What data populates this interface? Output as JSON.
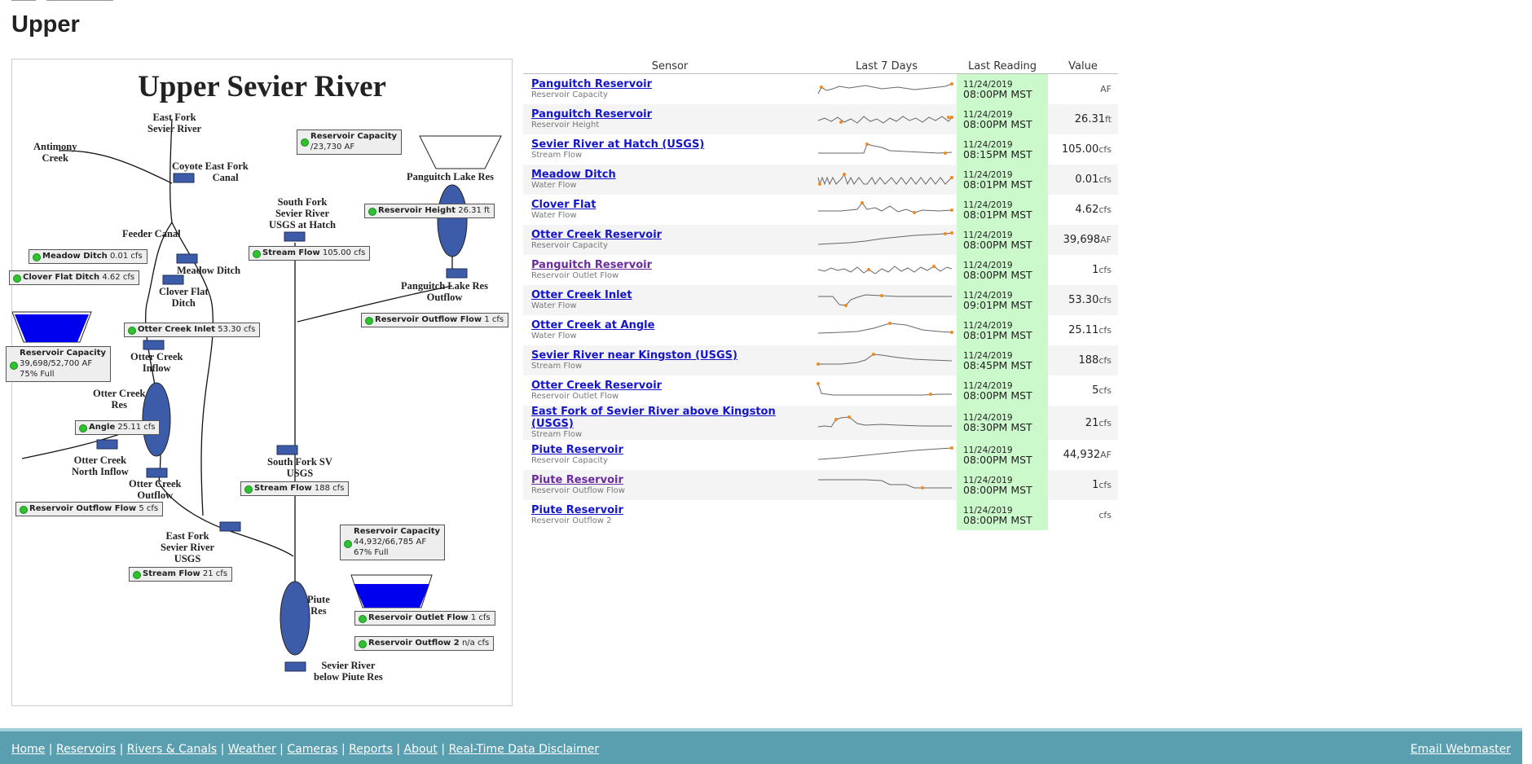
{
  "page": {
    "title": "Upper"
  },
  "diagram": {
    "title": "Upper Sevier River",
    "labels": {
      "east_fork": "East Fork\nSevier River",
      "antimony": "Antimony\nCreek",
      "coyote": "Coyote East Fork\nCanal",
      "feeder": "Feeder Canal",
      "meadow_ditch": "Meadow Ditch",
      "clover_flat": "Clover Flat\nDitch",
      "otter_inflow": "Otter Creek\nInflow",
      "otter_res": "Otter Creek\nRes",
      "otter_north": "Otter Creek\nNorth Inflow",
      "otter_outflow": "Otter Creek\nOutflow",
      "ef_usgs": "East Fork\nSevier River\nUSGS",
      "south_fork_hatch": "South Fork\nSevier River\nUSGS at Hatch",
      "panguitch_res": "Panguitch Lake Res",
      "panguitch_outflow": "Panguitch Lake Res\nOutflow",
      "sf_usgs": "South Fork SV\nUSGS",
      "piute_res": "Piute\nRes",
      "below_piute": "Sevier River\nbelow Piute Res"
    },
    "boxes": {
      "pang_cap": {
        "title": "Reservoir Capacity",
        "line": "/23,730 AF"
      },
      "pang_height": {
        "name": "Reservoir Height",
        "value": "26.31 ft"
      },
      "meadow": {
        "name": "Meadow Ditch",
        "value": "0.01 cfs"
      },
      "clover": {
        "name": "Clover Flat Ditch",
        "value": "4.62 cfs"
      },
      "hatch_flow": {
        "name": "Stream Flow",
        "value": "105.00 cfs"
      },
      "pang_outflow": {
        "name": "Reservoir Outflow Flow",
        "value": "1 cfs"
      },
      "otter_inlet": {
        "name": "Otter Creek Inlet",
        "value": "53.30 cfs"
      },
      "otter_cap": {
        "title": "Reservoir Capacity",
        "line1": "39,698/52,700 AF",
        "line2": "75% Full"
      },
      "angle": {
        "name": "Angle",
        "value": "25.11 cfs"
      },
      "otter_outflow": {
        "name": "Reservoir Outflow Flow",
        "value": "5 cfs"
      },
      "sf_flow": {
        "name": "Stream Flow",
        "value": "188 cfs"
      },
      "ef_flow": {
        "name": "Stream Flow",
        "value": "21 cfs"
      },
      "piute_cap": {
        "title": "Reservoir Capacity",
        "line1": "44,932/66,785 AF",
        "line2": "67% Full"
      },
      "piute_outflow": {
        "name": "Reservoir Outlet Flow",
        "value": "1 cfs"
      },
      "piute_outflow2": {
        "name": "Reservoir Outflow 2",
        "value": "n/a cfs"
      }
    }
  },
  "table": {
    "headers": {
      "sensor": "Sensor",
      "days": "Last 7 Days",
      "reading": "Last Reading",
      "value": "Value"
    },
    "rows": [
      {
        "name": "Panguitch Reservoir",
        "sub": "Reservoir Capacity",
        "date": "11/24/2019",
        "time": "08:00PM MST",
        "value": "",
        "unit": "AF"
      },
      {
        "name": "Panguitch Reservoir",
        "sub": "Reservoir Height",
        "date": "11/24/2019",
        "time": "08:00PM MST",
        "value": "26.31",
        "unit": "ft"
      },
      {
        "name": "Sevier River at Hatch (USGS)",
        "sub": "Stream Flow",
        "date": "11/24/2019",
        "time": "08:15PM MST",
        "value": "105.00",
        "unit": "cfs"
      },
      {
        "name": "Meadow Ditch",
        "sub": "Water Flow",
        "date": "11/24/2019",
        "time": "08:01PM MST",
        "value": "0.01",
        "unit": "cfs"
      },
      {
        "name": "Clover Flat",
        "sub": "Water Flow",
        "date": "11/24/2019",
        "time": "08:01PM MST",
        "value": "4.62",
        "unit": "cfs"
      },
      {
        "name": "Otter Creek Reservoir",
        "sub": "Reservoir Capacity",
        "date": "11/24/2019",
        "time": "08:00PM MST",
        "value": "39,698",
        "unit": "AF"
      },
      {
        "name": "Panguitch Reservoir",
        "sub": "Reservoir Outlet Flow",
        "date": "11/24/2019",
        "time": "08:00PM MST",
        "value": "1",
        "unit": "cfs"
      },
      {
        "name": "Otter Creek Inlet",
        "sub": "Water Flow",
        "date": "11/24/2019",
        "time": "09:01PM MST",
        "value": "53.30",
        "unit": "cfs"
      },
      {
        "name": "Otter Creek at Angle",
        "sub": "Water Flow",
        "date": "11/24/2019",
        "time": "08:01PM MST",
        "value": "25.11",
        "unit": "cfs"
      },
      {
        "name": "Sevier River near Kingston (USGS)",
        "sub": "Stream Flow",
        "date": "11/24/2019",
        "time": "08:45PM MST",
        "value": "188",
        "unit": "cfs"
      },
      {
        "name": "Otter Creek Reservoir",
        "sub": "Reservoir Outlet Flow",
        "date": "11/24/2019",
        "time": "08:00PM MST",
        "value": "5",
        "unit": "cfs"
      },
      {
        "name": "East Fork of Sevier River above Kingston (USGS)",
        "sub": "Stream Flow",
        "date": "11/24/2019",
        "time": "08:30PM MST",
        "value": "21",
        "unit": "cfs"
      },
      {
        "name": "Piute Reservoir",
        "sub": "Reservoir Capacity",
        "date": "11/24/2019",
        "time": "08:00PM MST",
        "value": "44,932",
        "unit": "AF"
      },
      {
        "name": "Piute Reservoir",
        "sub": "Reservoir Outflow Flow",
        "date": "11/24/2019",
        "time": "08:00PM MST",
        "value": "1",
        "unit": "cfs"
      },
      {
        "name": "Piute Reservoir",
        "sub": "Reservoir Outflow 2",
        "date": "11/24/2019",
        "time": "08:00PM MST",
        "value": "",
        "unit": "cfs"
      }
    ]
  },
  "footer": {
    "links": [
      "Home",
      "Reservoirs",
      "Rivers & Canals",
      "Weather",
      "Cameras",
      "Reports",
      "About",
      "Real-Time Data Disclaimer"
    ],
    "email": "Email Webmaster"
  },
  "colors": {
    "reservoir_fill": "#0000ee",
    "station_fill": "#3c5ba8",
    "reading_bg": "#ccf9cc",
    "footer_bg": "#5a9fb0"
  }
}
